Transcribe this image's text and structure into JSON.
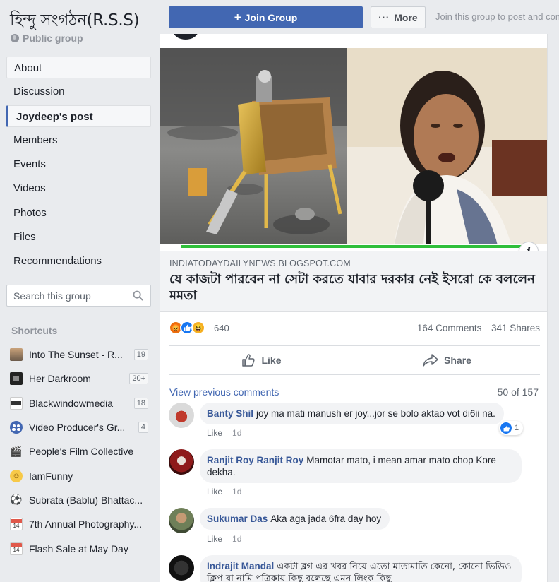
{
  "group": {
    "title": "হিন্দু সংগঠন(R.S.S)",
    "privacy": "Public group"
  },
  "nav": [
    {
      "label": "About"
    },
    {
      "label": "Discussion"
    },
    {
      "label": "Joydeep's post"
    },
    {
      "label": "Members"
    },
    {
      "label": "Events"
    },
    {
      "label": "Videos"
    },
    {
      "label": "Photos"
    },
    {
      "label": "Files"
    },
    {
      "label": "Recommendations"
    }
  ],
  "search": {
    "placeholder": "Search this group"
  },
  "shortcuts": {
    "title": "Shortcuts",
    "items": [
      {
        "label": "Into The Sunset - R...",
        "badge": "19"
      },
      {
        "label": "Her Darkroom",
        "badge": "20+"
      },
      {
        "label": "Blackwindowmedia",
        "badge": "18"
      },
      {
        "label": "Video Producer's Gr...",
        "badge": "4"
      },
      {
        "label": "People's Film Collective",
        "badge": ""
      },
      {
        "label": "IamFunny",
        "badge": ""
      },
      {
        "label": "Subrata (Bablu) Bhattac...",
        "badge": ""
      },
      {
        "label": "7th Annual Photography...",
        "badge": ""
      },
      {
        "label": "Flash Sale at May Day",
        "badge": ""
      }
    ]
  },
  "topbar": {
    "join_label": "Join Group",
    "more_label": "More",
    "hint": "Join this group to post and comment."
  },
  "post": {
    "link_domain": "INDIATODAYDAILYNEWS.BLOGSPOT.COM",
    "link_title": "যে কাজটা পারবেন না সেটা করতে যাবার দরকার নেই ইসরো কে বললেন মমতা",
    "reaction_count": "640",
    "comments_count": "164 Comments",
    "shares_count": "341 Shares",
    "like_label": "Like",
    "share_label": "Share",
    "view_previous": "View previous comments",
    "pager": "50 of 157"
  },
  "comments": [
    {
      "name": "Banty Shil",
      "text": "joy ma mati manush er joy...jor se bolo aktao vot di6ii na.",
      "like": "Like",
      "time": "1d",
      "reactions": "1"
    },
    {
      "name": "Ranjit Roy Ranjit Roy",
      "text": "Mamotar mato, i mean amar mato chop Kore dekha.",
      "like": "Like",
      "time": "1d"
    },
    {
      "name": "Sukumar Das",
      "text": "Aka aga jada 6fra day hoy",
      "like": "Like",
      "time": "1d"
    },
    {
      "name": "Indrajit Mandal",
      "text": "একটা ব্লগ এর খবর নিয়ে এতো মাতামাতি কেনো, কোনো ভিডিও ক্লিপ বা নামি পত্রিকায় কিছু বলেছে এমন লিংক কিছু"
    }
  ],
  "icons": {
    "join": "plus-icon",
    "more": "ellipsis-icon",
    "like": "thumbs-up-icon",
    "share": "share-arrow-icon",
    "search": "search-icon",
    "info": "info-icon"
  },
  "colors": {
    "brand": "#4267b2",
    "link_name": "#385898",
    "background": "#e9ebee"
  }
}
